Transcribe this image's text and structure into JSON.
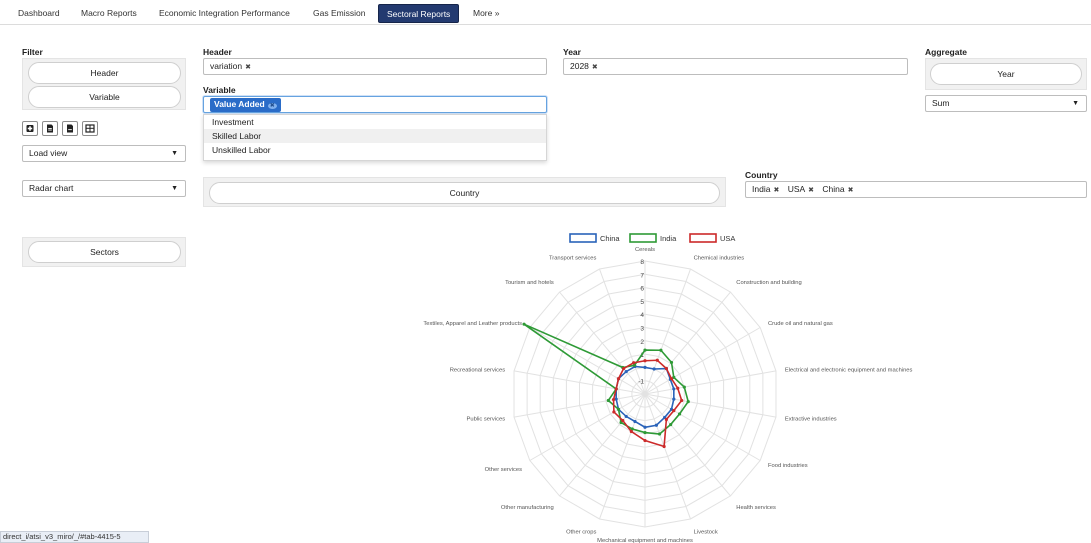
{
  "nav": {
    "tabs": [
      {
        "label": "Dashboard"
      },
      {
        "label": "Macro Reports"
      },
      {
        "label": "Economic Integration Performance"
      },
      {
        "label": "Gas Emission"
      },
      {
        "label": "Sectoral Reports"
      },
      {
        "label": "More »"
      }
    ],
    "active_index": 4
  },
  "filter": {
    "label": "Filter",
    "header_button": "Header",
    "variable_button": "Variable",
    "load_view": "Load view",
    "chart_type": "Radar chart",
    "sectors_button": "Sectors"
  },
  "header_field": {
    "label": "Header",
    "tags": [
      "variation"
    ]
  },
  "year_field": {
    "label": "Year",
    "tags": [
      "2028"
    ]
  },
  "aggregate": {
    "label": "Aggregate",
    "year_button": "Year",
    "function": "Sum"
  },
  "variable_field": {
    "label": "Variable",
    "selected": "Value Added",
    "options": [
      "Investment",
      "Skilled Labor",
      "Unskilled Labor"
    ],
    "highlighted_index": 1
  },
  "country": {
    "button": "Country",
    "label": "Country",
    "tags": [
      "India",
      "USA",
      "China"
    ]
  },
  "status_bar": "direct_i/atsi_v3_miro/_/#tab-4415-5",
  "colors": {
    "nav_active": "#233a70",
    "china": "#2a63b9",
    "india": "#2e9a36",
    "usa": "#cc2a2a"
  },
  "chart_data": {
    "type": "radar",
    "categories": [
      "Cereals",
      "Chemical industries",
      "Construction and building",
      "Crude oil and natural gas",
      "Electrical and electronic equipment and machines",
      "Extractive industries",
      "Food industries",
      "Health services",
      "Livestock",
      "Mechanical equipment and machines",
      "Other crops",
      "Other manufacturing",
      "Other services",
      "Public services",
      "Recreational services",
      "Textiles, Apparel and Leather products",
      "Tourism and hotels",
      "Transport services"
    ],
    "r_ticks": [
      "8",
      "7",
      "6",
      "5",
      "4",
      "3",
      "2",
      "1",
      "-1"
    ],
    "r_min": -2,
    "r_max": 8,
    "legend": "top",
    "series": [
      {
        "name": "China",
        "values": [
          0,
          0,
          0.5,
          0.2,
          0.2,
          0.2,
          0.3,
          0.3,
          0.5,
          0.5,
          0.2,
          0.2,
          0.3,
          0.2,
          0.2,
          0.3,
          0.2,
          0.2
        ]
      },
      {
        "name": "India",
        "values": [
          1.3,
          1.5,
          1.1,
          0.5,
          1.0,
          1.3,
          1.0,
          1.0,
          1.2,
          0.9,
          0.8,
          0.8,
          0.3,
          0.8,
          0.2,
          8.5,
          0.6,
          0.3
        ]
      },
      {
        "name": "USA",
        "values": [
          0.5,
          0.7,
          0.5,
          0.3,
          0.5,
          0.8,
          0.5,
          0.5,
          2.2,
          1.5,
          1.0,
          0.6,
          0.7,
          0.4,
          0.2,
          0.3,
          0.5,
          0.5
        ]
      }
    ]
  }
}
